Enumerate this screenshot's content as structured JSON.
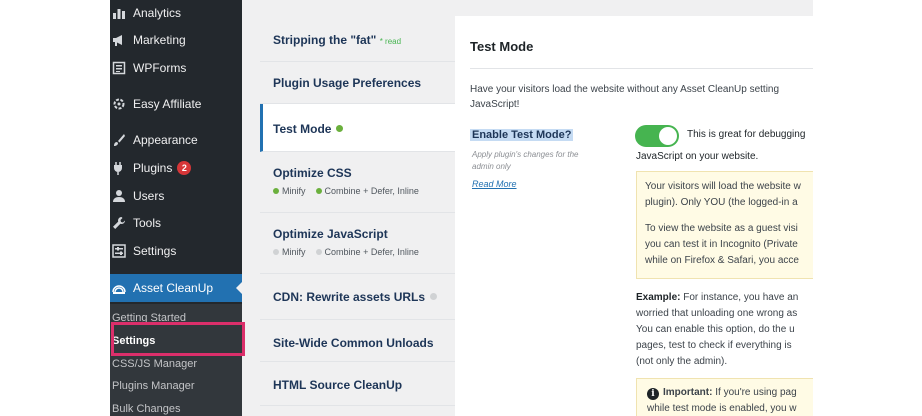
{
  "sidebar": {
    "items": [
      {
        "label": "Analytics",
        "icon": "bar-chart-icon"
      },
      {
        "label": "Marketing",
        "icon": "megaphone-icon"
      },
      {
        "label": "WPForms",
        "icon": "form-icon"
      },
      {
        "label": "Easy Affiliate",
        "icon": "gear-cycle-icon"
      },
      {
        "label": "Appearance",
        "icon": "paintbrush-icon"
      },
      {
        "label": "Plugins",
        "icon": "plug-icon",
        "badge": "2"
      },
      {
        "label": "Users",
        "icon": "user-icon"
      },
      {
        "label": "Tools",
        "icon": "wrench-icon"
      },
      {
        "label": "Settings",
        "icon": "settings-sliders-icon"
      },
      {
        "label": "Asset CleanUp",
        "icon": "asset-cleanup-icon"
      }
    ],
    "submenu": [
      "Getting Started",
      "Settings",
      "CSS/JS Manager",
      "Plugins Manager",
      "Bulk Changes"
    ]
  },
  "settings_nav": {
    "stripping": {
      "title": "Stripping the \"fat\"",
      "note": "* read"
    },
    "plugin_usage": {
      "title": "Plugin Usage Preferences"
    },
    "test_mode": {
      "title": "Test Mode",
      "status": "enabled"
    },
    "optimize_css": {
      "title": "Optimize CSS",
      "minify": "Minify",
      "combine": "Combine",
      "extra": "+ Defer, Inline"
    },
    "optimize_js": {
      "title": "Optimize JavaScript",
      "minify": "Minify",
      "combine": "Combine",
      "extra": "+ Defer, Inline"
    },
    "cdn": {
      "title": "CDN: Rewrite assets URLs"
    },
    "site_wide": {
      "title": "Site-Wide Common Unloads"
    },
    "html_cleanup": {
      "title": "HTML Source CleanUp"
    }
  },
  "content": {
    "title": "Test Mode",
    "intro_line1": "Have your visitors load the website without any Asset CleanUp setting",
    "intro_line2": "JavaScript!",
    "enable_label": "Enable Test Mode?",
    "enable_hint": "Apply plugin's changes for the admin only",
    "read_more": "Read More",
    "toggle_on": true,
    "toggle_text": "This is great for debugging",
    "toggle_text2": "JavaScript on your website.",
    "notice_lines": [
      "Your visitors will load the website w",
      "plugin). Only YOU (the logged-in a",
      "To view the website as a guest visi",
      "you can test it in Incognito (Private",
      "while on Firefox & Safari, you acce"
    ],
    "example_label": "Example:",
    "example_lines": [
      " For instance, you have an",
      "worried that unloading one wrong as",
      "You can enable this option, do the u",
      "pages, test to check if everything is",
      "(not only the admin)."
    ],
    "important_label": "Important:",
    "important_line1": " If you're using pag",
    "important_line2": "while test mode is enabled, you w"
  }
}
